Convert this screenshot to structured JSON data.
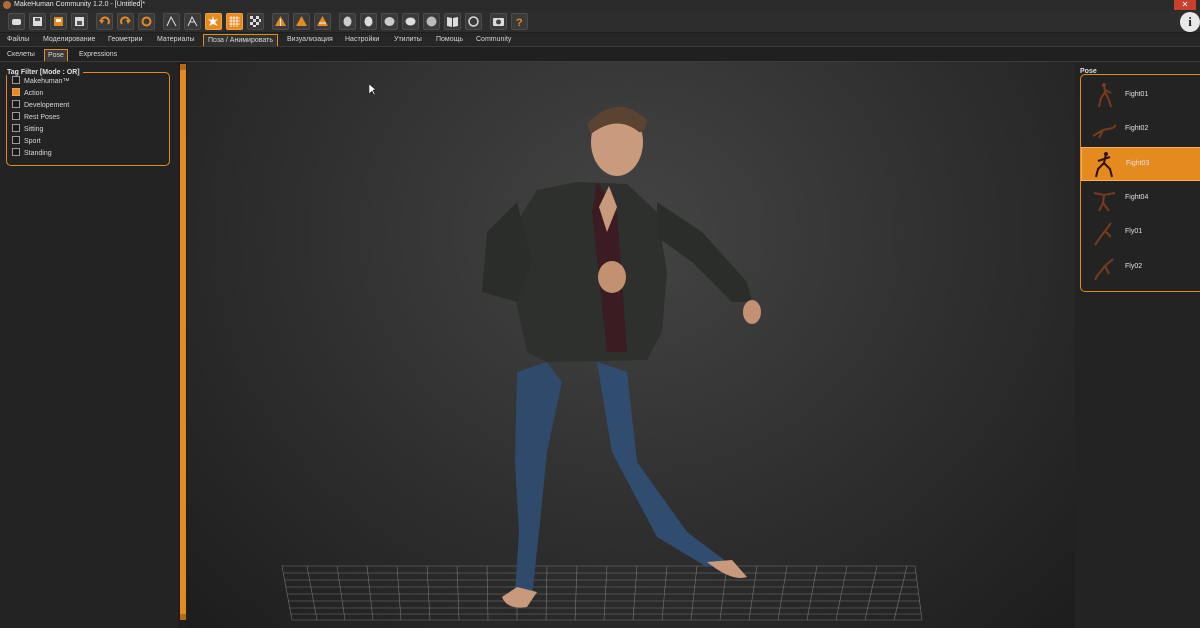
{
  "window": {
    "title": "MakeHuman Community 1.2.0 - [Untitled]*"
  },
  "toolbar": {
    "buttons": [
      "new-icon",
      "save-icon",
      "export-icon",
      "load-icon",
      "undo-icon",
      "redo-icon",
      "reset-icon",
      "smooth-icon",
      "wireframe-icon",
      "pose-icon",
      "grid-icon",
      "checker-icon",
      "front-view-icon",
      "side-view-icon",
      "top-view-icon",
      "head-left-icon",
      "head-front-icon",
      "head-right-icon",
      "head-back-icon",
      "head-top-icon",
      "book-icon",
      "ring-icon",
      "camera-icon",
      "help-icon"
    ],
    "active": [
      "pose-icon",
      "grid-icon"
    ]
  },
  "main_tabs": [
    {
      "label": "Файлы"
    },
    {
      "label": "Моделирование"
    },
    {
      "label": "Геометрии"
    },
    {
      "label": "Материалы"
    },
    {
      "label": "Поза / Анимировать",
      "active": true
    },
    {
      "label": "Визуализация"
    },
    {
      "label": "Настройки"
    },
    {
      "label": "Утилиты"
    },
    {
      "label": "Помощь"
    },
    {
      "label": "Community"
    }
  ],
  "sub_tabs": [
    {
      "label": "Скелеты"
    },
    {
      "label": "Pose",
      "active": true
    },
    {
      "label": "Expressions"
    }
  ],
  "tag_filter": {
    "title": "Tag Filter [Mode : OR]",
    "items": [
      {
        "label": "Makehuman™",
        "checked": false
      },
      {
        "label": "Action",
        "checked": true
      },
      {
        "label": "Developement",
        "checked": false
      },
      {
        "label": "Rest Poses",
        "checked": false
      },
      {
        "label": "Sitting",
        "checked": false
      },
      {
        "label": "Sport",
        "checked": false
      },
      {
        "label": "Standing",
        "checked": false
      }
    ]
  },
  "pose_panel": {
    "title": "Pose",
    "items": [
      {
        "label": "Fight01",
        "selected": false
      },
      {
        "label": "Fight02",
        "selected": false
      },
      {
        "label": "Fight03",
        "selected": true
      },
      {
        "label": "Fight04",
        "selected": false
      },
      {
        "label": "Fly01",
        "selected": false
      },
      {
        "label": "Fly02",
        "selected": false
      }
    ]
  },
  "colors": {
    "accent": "#e58a1f",
    "background": "#1e1e1e",
    "panel": "#232323"
  }
}
